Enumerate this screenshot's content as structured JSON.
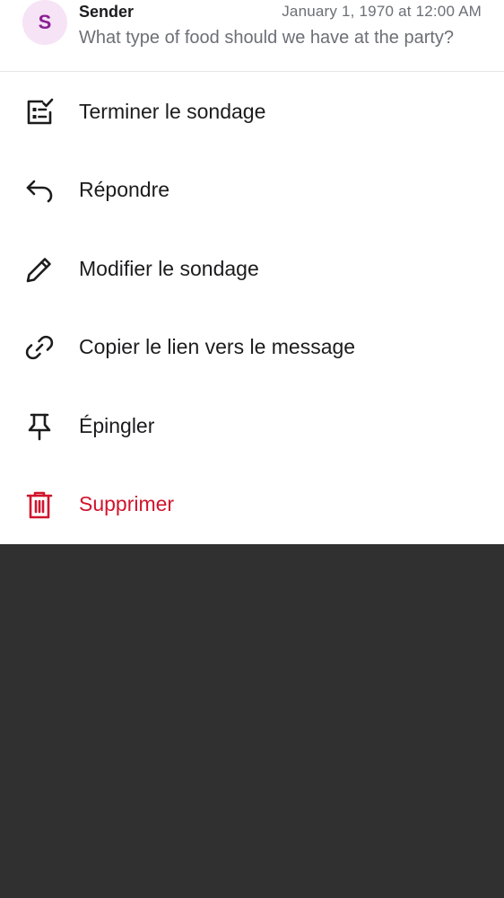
{
  "message": {
    "avatar_initial": "S",
    "sender": "Sender",
    "timestamp": "January 1, 1970 at 12:00 AM",
    "preview": "What type of food should we have at the party?"
  },
  "menu": {
    "items": [
      {
        "label": "Terminer le sondage",
        "icon": "end-poll-icon"
      },
      {
        "label": "Répondre",
        "icon": "reply-icon"
      },
      {
        "label": "Modifier le sondage",
        "icon": "pencil-icon"
      },
      {
        "label": "Copier le lien vers le message",
        "icon": "link-icon"
      },
      {
        "label": "Épingler",
        "icon": "pin-icon"
      },
      {
        "label": "Supprimer",
        "icon": "trash-icon"
      }
    ]
  },
  "colors": {
    "avatar_bg": "#f6e3f6",
    "avatar_text": "#8b1f93",
    "danger": "#d0142c",
    "scrim": "#303030"
  }
}
